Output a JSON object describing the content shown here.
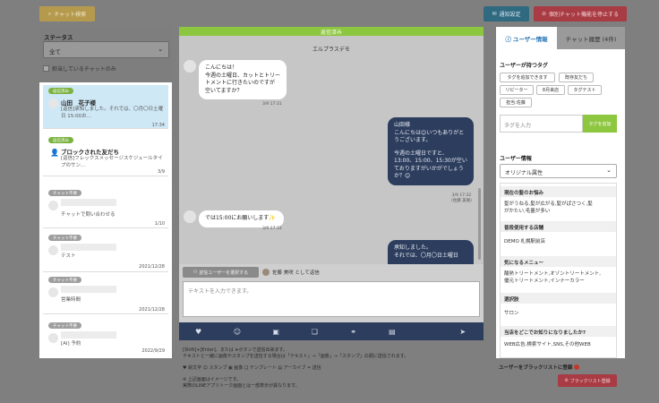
{
  "toolbar": {
    "search_btn": "チャット検索",
    "notify_btn": "通知設定",
    "stop_btn": "個別チャット機能を停止する"
  },
  "filter": {
    "status_label": "ステータス",
    "status_value": "全て",
    "own_only": "担当しているチャットのみ"
  },
  "chat_list": [
    {
      "badge": "返信済み",
      "name": "山田　花子様",
      "preview": "[返信]承知しました。それでは、〇月〇日土曜日 15:00お...",
      "date": "17:34"
    },
    {
      "badge": "返信済み",
      "name": "ブロックされた友だち",
      "preview": "[返信]フレックスメッセージスケジュールタイプのサン...",
      "date": "3/9"
    },
    {
      "badge": "チャット不要",
      "name": "",
      "preview": "チャットで問い合わせる",
      "date": "1/10"
    },
    {
      "badge": "チャット不要",
      "name": "",
      "preview": "テスト",
      "date": "2021/12/28"
    },
    {
      "badge": "チャット不要",
      "name": "",
      "preview": "営業時間",
      "date": "2021/12/28"
    },
    {
      "badge": "チャット不要",
      "name": "",
      "preview": "[AI] 予約",
      "date": "2022/9/29"
    }
  ],
  "chat": {
    "header": "返信済み",
    "room": "エルプラスデモ",
    "m1_l1": "こんにちは！",
    "m1_l2": "今週の土曜日、カットとトリー",
    "m1_l3": "トメントに行きたいのですが",
    "m1_l4": "空いてますか？",
    "m1_time": "3/9 17:31",
    "m2_l1": "山田様",
    "m2_l2": "こんにちは😊いつもありがと",
    "m2_l3": "うございます。",
    "m2_l4": "今週の土曜日ですと、",
    "m2_l5": "13:00、15:00、15:30が空い",
    "m2_l6": "ておりますがいかがでしょう",
    "m2_l7": "か？😊",
    "m2_time": "3/9 17:32",
    "m2_sender": "(佐藤 美咲)",
    "m3": "では15:00にお願いします✨",
    "m3_time": "3/9 17:33",
    "m4_l1": "承知しました。",
    "m4_l2": "それでは、〇月〇日土曜日"
  },
  "composer": {
    "pick_user": "返信ユーザーを選択する",
    "send_as": "佐藤 美咲 として返信",
    "placeholder": "テキストを入力できます。"
  },
  "tools": [
    "♥",
    "☺",
    "▣",
    "❏",
    "⚭",
    "▤",
    "➤"
  ],
  "help": {
    "l1": "[Shift]+[Enter]、または ➤ボタンで送信出来ます。",
    "l2": "テキストと一緒に画像やスタンプを送信する場合は「テキスト」→「画像」→「スタンプ」の順に送信されます。",
    "l3": "♥ 絵文字 ☺ スタンプ ▣ 画像 ❏ テンプレート ▤ アーカイブ ⚭ 送信",
    "l4": "※ 上記画面はイメージです。",
    "l5": "実際のLINEアプリトーク画面とは一部表示が異なります。"
  },
  "right": {
    "tab_user": "ユーザー情報",
    "tab_history": "チャット履歴 (4件)",
    "tags_title": "ユーザーが持つタグ",
    "tags": [
      "タグを追加できます",
      "既存友だち",
      "リピーター",
      "8月来店",
      "タグテスト",
      "担当:佐藤"
    ],
    "tag_placeholder": "タグを入力",
    "tag_add": "タグを追加",
    "info_title": "ユーザー情報",
    "attr_select": "オリジナル属性",
    "q1": "現在の髪のお悩み",
    "a1_l1": "髪がうねる,髪が広がる,髪がぱさつく,髪",
    "a1_l2": "がかたい,毛量が多い",
    "q2": "普段使用する店舗",
    "a2": "DEMO 札幌駅前店",
    "q3": "気になるメニュー",
    "a3_l1": "酸熱トリートメント,オゾントリートメント,",
    "a3_l2": "優元トリートメント,インナーカラー",
    "q4": "選択肢",
    "a4": "サロン",
    "q5": "当店をどこでお知りになりましたか?",
    "a5": "WEB広告,検索サイト,SNS,その他WEB",
    "block_label": "ユーザーをブラックリストに登録",
    "block_btn": "ブラックリスト登録"
  },
  "colors": {
    "accent_green": "#8dc63f",
    "navy": "#2c3d5d",
    "red": "#a83b43",
    "link_blue": "#2f78b4"
  }
}
